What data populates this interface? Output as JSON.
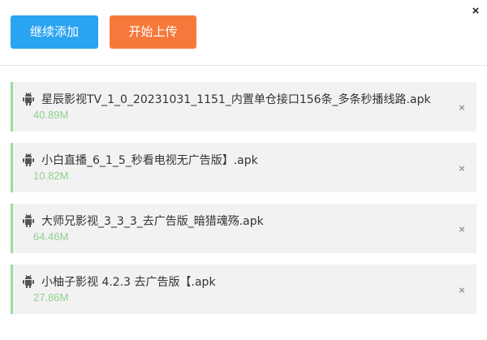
{
  "dialog": {
    "close_glyph": "×"
  },
  "toolbar": {
    "continue_label": "继续添加",
    "start_label": "开始上传"
  },
  "files": [
    {
      "name": "星辰影视TV_1_0_20231031_1151_内置单仓接口156条_多条秒播线路.apk",
      "size": "40.89M",
      "remove_glyph": "×"
    },
    {
      "name": "小白直播_6_1_5_秒看电视无广告版】.apk",
      "size": "10.82M",
      "remove_glyph": "×"
    },
    {
      "name": "大师兄影视_3_3_3_去广告版_暗猎魂殇.apk",
      "size": "64.46M",
      "remove_glyph": "×"
    },
    {
      "name": "小柚子影视 4.2.3 去广告版【.apk",
      "size": "27.86M",
      "remove_glyph": "×"
    }
  ],
  "colors": {
    "continue_button": "#2aa3f1",
    "start_button": "#f6793b",
    "item_border": "#9bdc9b",
    "size_text": "#8fd18f"
  },
  "icons": {
    "file_icon": "android-icon",
    "remove_icon": "close-icon"
  }
}
